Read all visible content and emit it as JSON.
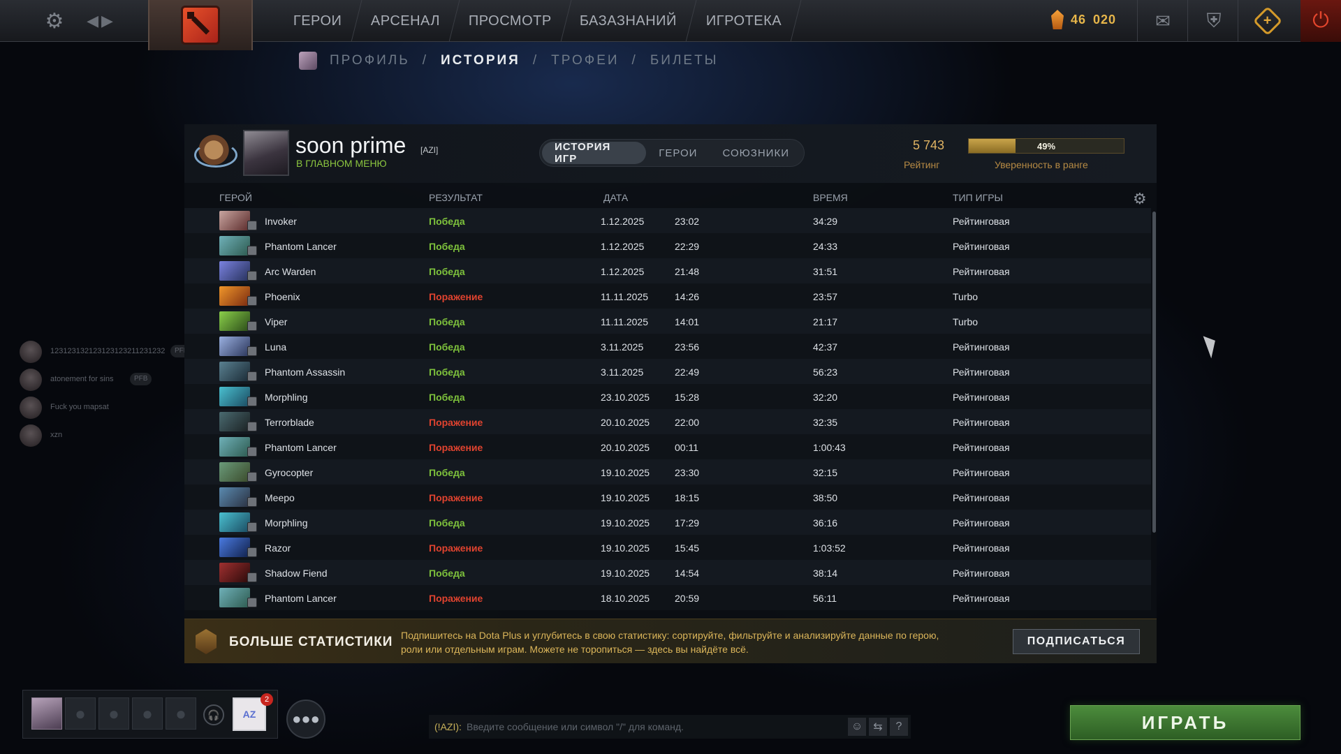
{
  "topnav": {
    "items": [
      "ГЕРОИ",
      "АРСЕНАЛ",
      "ПРОСМОТР",
      "БАЗАЗНАНИЙ",
      "ИГРОТЕКА"
    ],
    "currency_whole": "46",
    "currency_frac": "020"
  },
  "subnav": {
    "profile": "ПРОФИЛЬ",
    "history": "ИСТОРИЯ",
    "trophies": "ТРОФЕИ",
    "tickets": "БИЛЕТЫ",
    "separator": "/"
  },
  "profile": {
    "name": "soon prime",
    "tag": "[AZI]",
    "status": "В ГЛАВНОМ МЕНЮ",
    "rating": "5 743",
    "rating_label": "Рейтинг",
    "confidence": "49%",
    "confidence_fraction": 0.3,
    "confidence_label": "Уверенность в ранге"
  },
  "tabs": [
    "ИСТОРИЯ ИГР",
    "ГЕРОИ",
    "СОЮЗНИКИ"
  ],
  "columns": {
    "hero": "ГЕРОЙ",
    "result": "РЕЗУЛЬТАТ",
    "date": "ДАТА",
    "duration": "ВРЕМЯ",
    "type": "ТИП ИГРЫ"
  },
  "matches": [
    {
      "hero": "Invoker",
      "result": "Победа",
      "win": true,
      "date": "1.12.2025",
      "time": "23:02",
      "duration": "34:29",
      "type": "Рейтинговая",
      "color1": "#c8a5a0",
      "color2": "#5a2a2a"
    },
    {
      "hero": "Phantom Lancer",
      "result": "Победа",
      "win": true,
      "date": "1.12.2025",
      "time": "22:29",
      "duration": "24:33",
      "type": "Рейтинговая",
      "color1": "#6fb0b8",
      "color2": "#2d5a4f"
    },
    {
      "hero": "Arc Warden",
      "result": "Победа",
      "win": true,
      "date": "1.12.2025",
      "time": "21:48",
      "duration": "31:51",
      "type": "Рейтинговая",
      "color1": "#7a82e0",
      "color2": "#26305a"
    },
    {
      "hero": "Phoenix",
      "result": "Поражение",
      "win": false,
      "date": "11.11.2025",
      "time": "14:26",
      "duration": "23:57",
      "type": "Turbo",
      "color1": "#f0962a",
      "color2": "#7a2a10"
    },
    {
      "hero": "Viper",
      "result": "Победа",
      "win": true,
      "date": "11.11.2025",
      "time": "14:01",
      "duration": "21:17",
      "type": "Turbo",
      "color1": "#8ad04a",
      "color2": "#2a4a18"
    },
    {
      "hero": "Luna",
      "result": "Победа",
      "win": true,
      "date": "3.11.2025",
      "time": "23:56",
      "duration": "42:37",
      "type": "Рейтинговая",
      "color1": "#9ab0e0",
      "color2": "#2a355a"
    },
    {
      "hero": "Phantom Assassin",
      "result": "Победа",
      "win": true,
      "date": "3.11.2025",
      "time": "22:49",
      "duration": "56:23",
      "type": "Рейтинговая",
      "color1": "#5a8090",
      "color2": "#1a2a35"
    },
    {
      "hero": "Morphling",
      "result": "Победа",
      "win": true,
      "date": "23.10.2025",
      "time": "15:28",
      "duration": "32:20",
      "type": "Рейтинговая",
      "color1": "#4ac0d0",
      "color2": "#1a4a60"
    },
    {
      "hero": "Terrorblade",
      "result": "Поражение",
      "win": false,
      "date": "20.10.2025",
      "time": "22:00",
      "duration": "32:35",
      "type": "Рейтинговая",
      "color1": "#4a6a70",
      "color2": "#1a2022"
    },
    {
      "hero": "Phantom Lancer",
      "result": "Поражение",
      "win": false,
      "date": "20.10.2025",
      "time": "00:11",
      "duration": "1:00:43",
      "type": "Рейтинговая",
      "color1": "#6fb0b8",
      "color2": "#2d5a4f"
    },
    {
      "hero": "Gyrocopter",
      "result": "Победа",
      "win": true,
      "date": "19.10.2025",
      "time": "23:30",
      "duration": "32:15",
      "type": "Рейтинговая",
      "color1": "#6a9a7a",
      "color2": "#3a4a2a"
    },
    {
      "hero": "Meepo",
      "result": "Поражение",
      "win": false,
      "date": "19.10.2025",
      "time": "18:15",
      "duration": "38:50",
      "type": "Рейтинговая",
      "color1": "#5a8ab0",
      "color2": "#2a3040"
    },
    {
      "hero": "Morphling",
      "result": "Победа",
      "win": true,
      "date": "19.10.2025",
      "time": "17:29",
      "duration": "36:16",
      "type": "Рейтинговая",
      "color1": "#4ac0d0",
      "color2": "#1a4a60"
    },
    {
      "hero": "Razor",
      "result": "Поражение",
      "win": false,
      "date": "19.10.2025",
      "time": "15:45",
      "duration": "1:03:52",
      "type": "Рейтинговая",
      "color1": "#4a7ae0",
      "color2": "#10204a"
    },
    {
      "hero": "Shadow Fiend",
      "result": "Победа",
      "win": true,
      "date": "19.10.2025",
      "time": "14:54",
      "duration": "38:14",
      "type": "Рейтинговая",
      "color1": "#a03030",
      "color2": "#2a0a0a"
    },
    {
      "hero": "Phantom Lancer",
      "result": "Поражение",
      "win": false,
      "date": "18.10.2025",
      "time": "20:59",
      "duration": "56:11",
      "type": "Рейтинговая",
      "color1": "#6fb0b8",
      "color2": "#2d5a4f"
    }
  ],
  "plus_banner": {
    "title": "БОЛЬШЕ СТАТИСТИКИ",
    "description": "Подпишитесь на Dota Plus и углубитесь в свою статистику: сортируйте, фильтруйте и анализируйте данные по герою, роли или отдельным играм. Можете не торопиться — здесь вы найдёте всё.",
    "button": "ПОДПИСАТЬСЯ"
  },
  "friends": [
    {
      "name": "123123132123123123211231232",
      "badge": "PFB"
    },
    {
      "name": "atonement for sins",
      "badge": "PFB"
    },
    {
      "name": "Fuck you mapsat",
      "badge": ""
    },
    {
      "name": "xzn",
      "badge": ""
    }
  ],
  "party": {
    "notification_count": "2",
    "card_label": "AZ"
  },
  "chat": {
    "prefix": "(!AZI):",
    "placeholder": "Введите сообщение или символ \"/\" для команд.",
    "help": "?"
  },
  "play_button": "ИГРАТЬ"
}
